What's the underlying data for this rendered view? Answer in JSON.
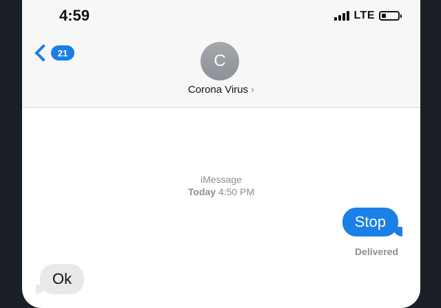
{
  "status_bar": {
    "time": "4:59",
    "network": "LTE"
  },
  "header": {
    "back_count": "21",
    "avatar_initial": "C",
    "contact_name": "Corona Virus",
    "chevron": "›"
  },
  "conversation": {
    "service": "iMessage",
    "day": "Today",
    "time": "4:50 PM",
    "messages": [
      {
        "direction": "outgoing",
        "text": "Stop"
      },
      {
        "direction": "incoming",
        "text": "Ok"
      }
    ],
    "delivered_label": "Delivered"
  },
  "colors": {
    "accent": "#1a7fe6",
    "incoming_bubble": "#e9e9eb"
  }
}
